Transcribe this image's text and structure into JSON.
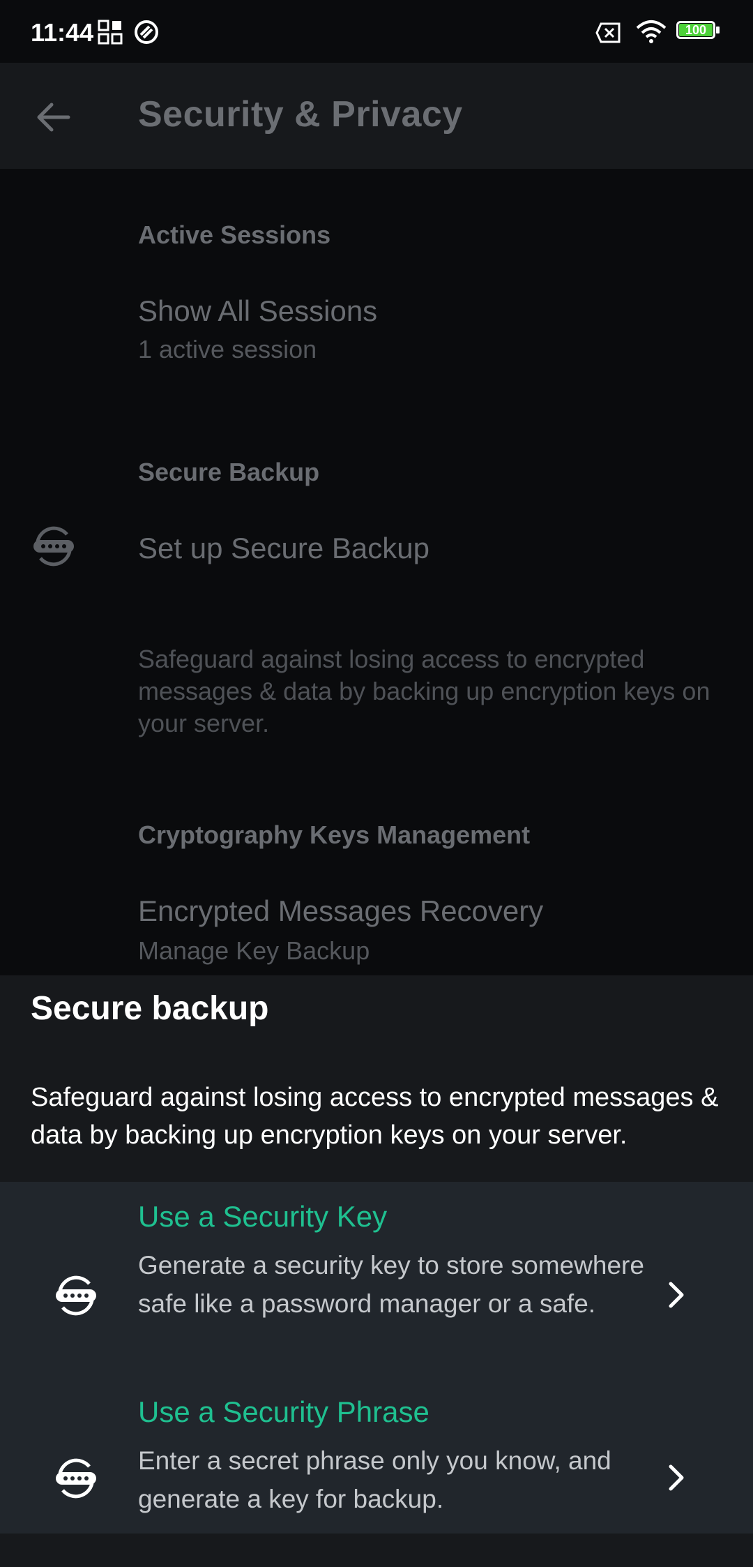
{
  "status_bar": {
    "time": "11:44",
    "battery": "100",
    "icons": [
      "qr-icon",
      "at-icon",
      "no-sim-icon",
      "wifi-icon",
      "battery-icon"
    ]
  },
  "app_bar": {
    "title": "Security & Privacy"
  },
  "settings": {
    "active_sessions_header": "Active Sessions",
    "show_all_sessions": "Show All Sessions",
    "active_session_count": "1 active session",
    "secure_backup_header": "Secure Backup",
    "setup_secure_backup": "Set up Secure Backup",
    "secure_backup_desc": "Safeguard against losing access to encrypted messages & data by backing up encryption keys on your server.",
    "crypto_header": "Cryptography Keys Management",
    "encrypted_recovery": "Encrypted Messages Recovery",
    "manage_key_backup": "Manage Key Backup"
  },
  "sheet": {
    "title": "Secure backup",
    "description": "Safeguard against losing access to encrypted messages & data by backing up encryption keys on your server.",
    "options": [
      {
        "title": "Use a Security Key",
        "description": "Generate a security key to store somewhere safe like a password manager or a safe."
      },
      {
        "title": "Use a Security Phrase",
        "description": "Enter a secret phrase only you know, and generate a key for backup."
      }
    ]
  },
  "colors": {
    "accent": "#1fc090",
    "background": "#0a0b0d",
    "sheet": "#17191c",
    "options_panel": "#21262c"
  }
}
